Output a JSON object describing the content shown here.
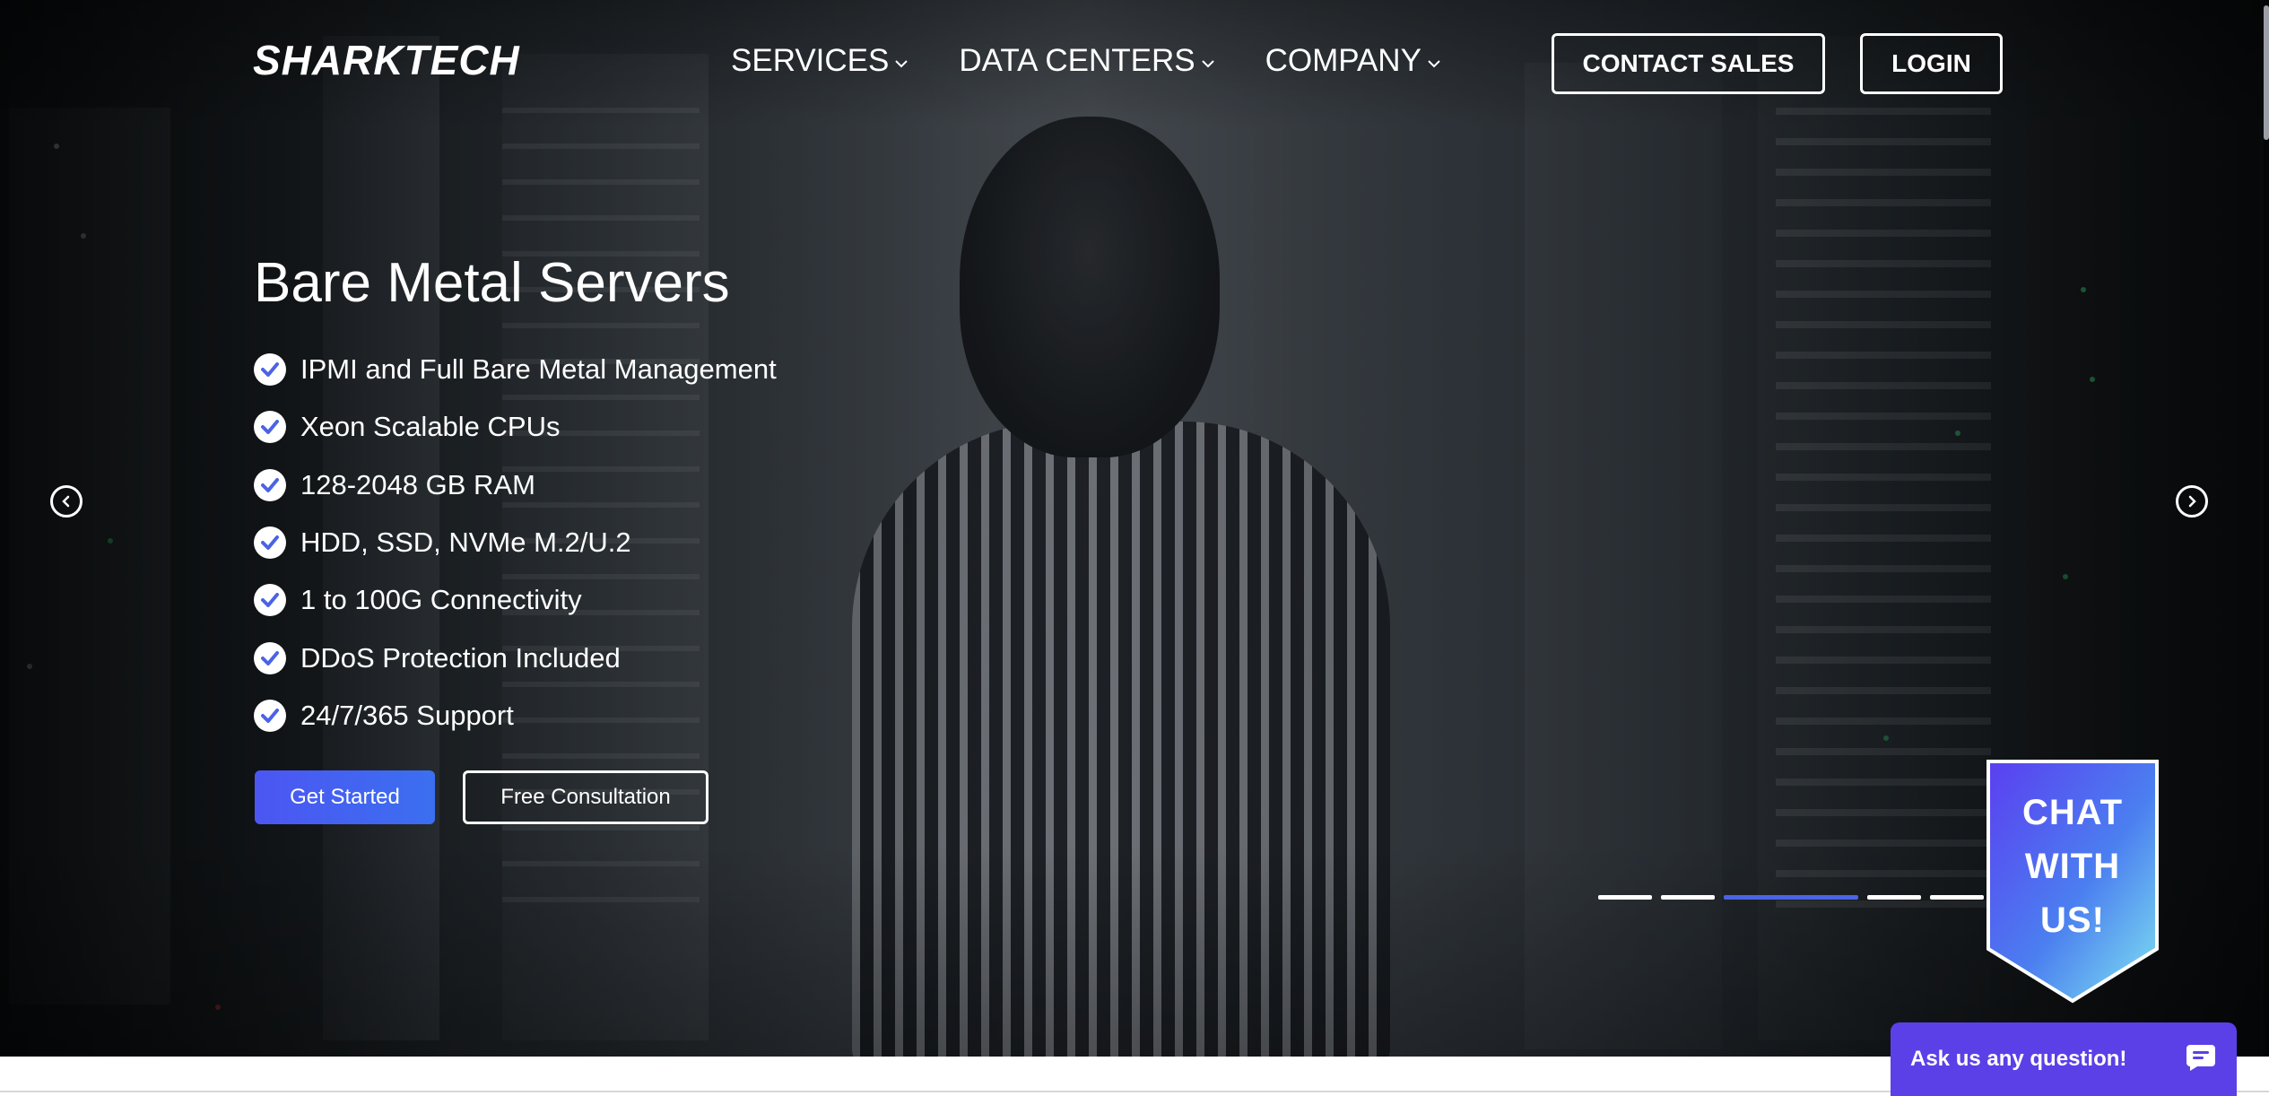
{
  "header": {
    "logo_text": "SHARKTECH",
    "nav": [
      {
        "label": "SERVICES"
      },
      {
        "label": "DATA CENTERS"
      },
      {
        "label": "COMPANY"
      }
    ],
    "contact_label": "CONTACT SALES",
    "login_label": "LOGIN"
  },
  "hero": {
    "title": "Bare Metal Servers",
    "features": [
      "IPMI and Full Bare Metal Management",
      "Xeon Scalable CPUs",
      "128-2048 GB RAM",
      "HDD, SSD, NVMe M.2/U.2",
      "1 to 100G Connectivity",
      "DDoS Protection Included",
      "24/7/365 Support"
    ],
    "primary_cta": "Get Started",
    "secondary_cta": "Free Consultation",
    "slides_total": 5,
    "active_slide": 3
  },
  "chat": {
    "badge_line1": "CHAT",
    "badge_line2": "WITH",
    "badge_line3": "US!",
    "ask_text": "Ask us any question!"
  },
  "colors": {
    "accent": "#4b63e6",
    "primary_button": "#4c56f2",
    "chat_bar": "#5b40e8",
    "check": "#4b63e6"
  },
  "icons": [
    "chevron-down-icon",
    "check-circle-icon",
    "arrow-left-circle-icon",
    "arrow-right-circle-icon",
    "chat-bubble-icon"
  ]
}
